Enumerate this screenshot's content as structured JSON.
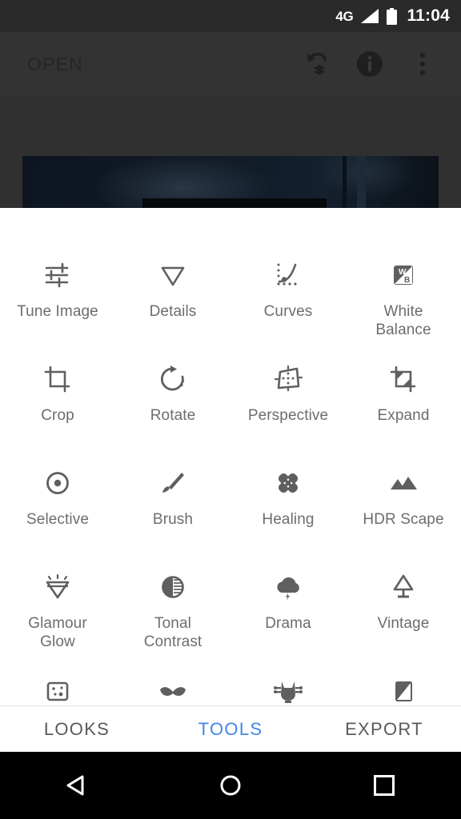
{
  "status_bar": {
    "network": "4G",
    "time": "11:04",
    "icons": [
      "signal-icon",
      "battery-icon"
    ]
  },
  "app_bar": {
    "title": "OPEN",
    "actions": [
      {
        "name": "undo-stack-icon",
        "label": "Undo"
      },
      {
        "name": "info-icon",
        "label": "Info"
      },
      {
        "name": "overflow-menu-icon",
        "label": "More"
      }
    ]
  },
  "tools": {
    "rows": [
      [
        {
          "label": "Tune Image",
          "icon": "sliders-icon"
        },
        {
          "label": "Details",
          "icon": "triangle-down-icon"
        },
        {
          "label": "Curves",
          "icon": "curves-icon"
        },
        {
          "label": "White\nBalance",
          "icon": "white-balance-icon"
        }
      ],
      [
        {
          "label": "Crop",
          "icon": "crop-icon"
        },
        {
          "label": "Rotate",
          "icon": "rotate-icon"
        },
        {
          "label": "Perspective",
          "icon": "perspective-icon"
        },
        {
          "label": "Expand",
          "icon": "expand-icon"
        }
      ],
      [
        {
          "label": "Selective",
          "icon": "selective-target-icon"
        },
        {
          "label": "Brush",
          "icon": "brush-icon"
        },
        {
          "label": "Healing",
          "icon": "bandage-icon"
        },
        {
          "label": "HDR Scape",
          "icon": "mountains-icon"
        }
      ],
      [
        {
          "label": "Glamour\nGlow",
          "icon": "diamond-glow-icon"
        },
        {
          "label": "Tonal\nContrast",
          "icon": "half-circle-contrast-icon"
        },
        {
          "label": "Drama",
          "icon": "storm-cloud-icon"
        },
        {
          "label": "Vintage",
          "icon": "lamp-icon"
        }
      ],
      [
        {
          "label": "",
          "icon": "grainy-film-icon"
        },
        {
          "label": "",
          "icon": "moustache-icon"
        },
        {
          "label": "",
          "icon": "guitar-head-icon"
        },
        {
          "label": "",
          "icon": "noir-frame-icon"
        }
      ]
    ]
  },
  "bottom_tabs": {
    "active": "TOOLS",
    "accent_color": "#4285e8",
    "items": [
      {
        "label": "LOOKS",
        "active": false
      },
      {
        "label": "TOOLS",
        "active": true
      },
      {
        "label": "EXPORT",
        "active": false
      }
    ]
  },
  "nav_bar": {
    "items": [
      {
        "name": "back-nav-icon",
        "label": "Back"
      },
      {
        "name": "home-nav-icon",
        "label": "Home"
      },
      {
        "name": "recents-nav-icon",
        "label": "Recents"
      }
    ]
  }
}
